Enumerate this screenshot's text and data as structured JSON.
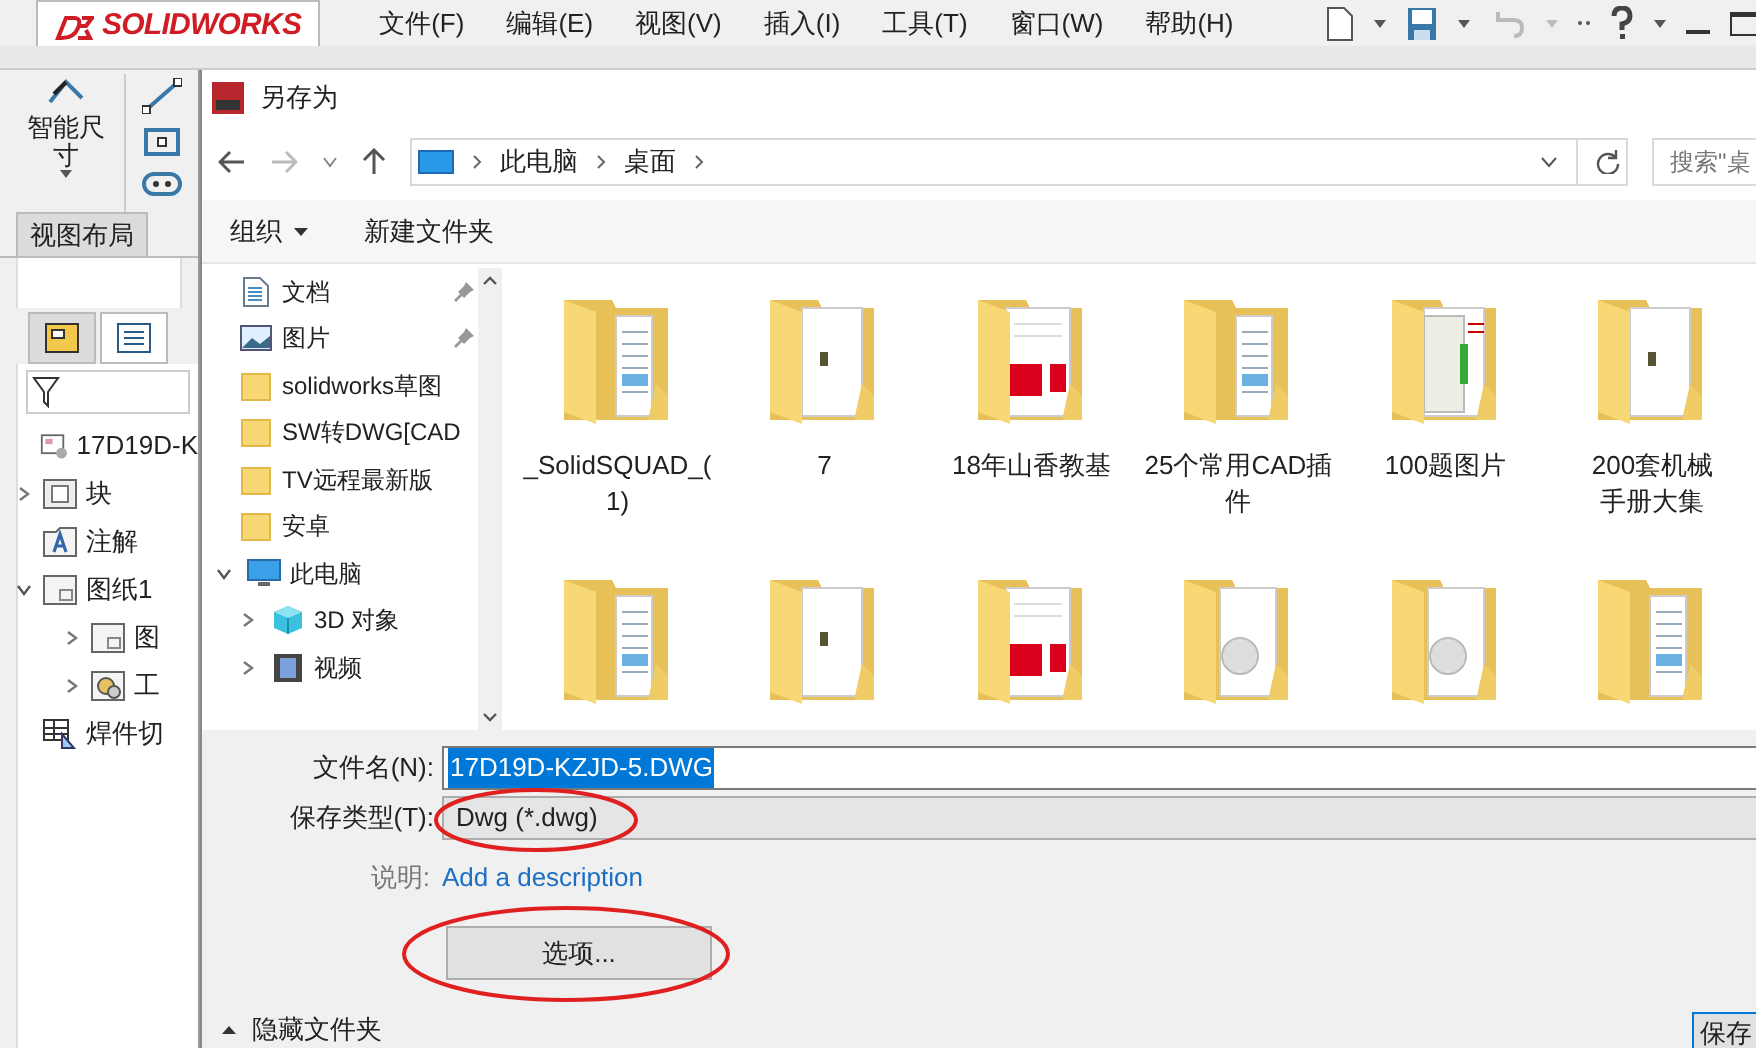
{
  "app": {
    "logo": "SOLIDWORKS",
    "menu": [
      "文件(F)",
      "编辑(E)",
      "视图(V)",
      "插入(I)",
      "工具(T)",
      "窗口(W)",
      "帮助(H)"
    ]
  },
  "sw_panel": {
    "smart_dimension": "智能尺寸",
    "tabs": [
      {
        "label": "视图布局",
        "selected": false
      }
    ],
    "tree": [
      {
        "label": "17D19D-K",
        "kind": "drawing"
      },
      {
        "label": "块",
        "kind": "block",
        "expanded": false
      },
      {
        "label": "注解",
        "kind": "note"
      },
      {
        "label": "图纸1",
        "kind": "sheet",
        "expanded": true,
        "children": [
          {
            "label": "图",
            "kind": "sheet",
            "expanded": false
          },
          {
            "label": "工",
            "kind": "part",
            "expanded": false
          }
        ]
      },
      {
        "label": "焊件切",
        "kind": "table"
      }
    ]
  },
  "dialog": {
    "title": "另存为",
    "breadcrumb": [
      "此电脑",
      "桌面"
    ],
    "search": {
      "placeholder": "搜索\"桌"
    },
    "toolbar": {
      "organize": "组织",
      "new_folder": "新建文件夹"
    },
    "nav": [
      {
        "label": "文档",
        "kind": "doc",
        "pinned": true
      },
      {
        "label": "图片",
        "kind": "picture",
        "pinned": true
      },
      {
        "label": "solidworks草图",
        "kind": "folder"
      },
      {
        "label": "SW转DWG[CAD",
        "kind": "folder"
      },
      {
        "label": "TV远程最新版",
        "kind": "folder"
      },
      {
        "label": "安卓",
        "kind": "folder"
      },
      {
        "label": "此电脑",
        "kind": "pc",
        "expanded": true,
        "children": [
          {
            "label": "3D 对象",
            "kind": "cube",
            "expanded": false
          },
          {
            "label": "视频",
            "kind": "video",
            "expanded": false
          }
        ]
      }
    ],
    "files": [
      {
        "label": [
          "_SolidSQUAD_(",
          "1)"
        ],
        "kind": "docs"
      },
      {
        "label": [
          "7"
        ],
        "kind": "paper"
      },
      {
        "label": [
          "18年山香教基"
        ],
        "kind": "pdf"
      },
      {
        "label": [
          "25个常用CAD插",
          "件"
        ],
        "kind": "docs"
      },
      {
        "label": [
          "100题图片"
        ],
        "kind": "drawing"
      },
      {
        "label": [
          "200套机械",
          "手册大集"
        ],
        "kind": "paper"
      },
      {
        "kind": "docs"
      },
      {
        "kind": "paper"
      },
      {
        "kind": "pdf"
      },
      {
        "kind": "disc"
      },
      {
        "kind": "disc"
      },
      {
        "kind": "docs"
      }
    ],
    "file_name": {
      "label": "文件名(N):",
      "value": "17D19D-KZJD-5.DWG"
    },
    "save_type": {
      "label": "保存类型(T):",
      "value": "Dwg (*.dwg)"
    },
    "description": {
      "label": "说明:",
      "link": "Add a description"
    },
    "options_button": "选项...",
    "hide_folders": "隐藏文件夹",
    "save_button": "保存"
  }
}
